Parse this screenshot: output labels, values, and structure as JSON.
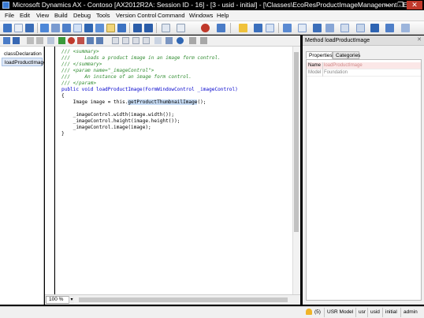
{
  "window": {
    "title": "Microsoft Dynamics AX - Contoso [AX2012R2A: Session ID - 16] - [3 - usid - initial] - [\\Classes\\EcoResProductImageManagement - Ed]",
    "minimize": "—",
    "maximize": "❐",
    "close": "✕"
  },
  "menu": [
    "File",
    "Edit",
    "View",
    "Build",
    "Debug",
    "Tools",
    "Version Control",
    "Command",
    "Windows",
    "Help"
  ],
  "methods": [
    "classDeclaration",
    "loadProductImage"
  ],
  "code": {
    "lines": [
      "/// <summary>",
      "///     Loads a product image in an image form control.",
      "/// </summary>",
      "/// <param name=\"_imageControl\">",
      "///     An instance of an image form control.",
      "/// </param>",
      "public void loadProductImage(FormWindowControl _imageControl)",
      "{",
      "    Image image = this.",
      "getProductThumbnailImage",
      "();",
      "",
      "    _imageControl.width(image.width());",
      "    _imageControl.height(image.height());",
      "    _imageControl.image(image);",
      "}"
    ]
  },
  "editor": {
    "zoom": "100 %"
  },
  "properties": {
    "title": "Method loadProductImage",
    "tabs": [
      "Properties",
      "Categories"
    ],
    "rows": [
      {
        "name": "Name",
        "value": "loadProductImage"
      },
      {
        "name": "Model",
        "value": "Foundation"
      }
    ]
  },
  "status": {
    "notifications": "(5)",
    "items": [
      "USR Model",
      "usr",
      "usid",
      "initial",
      "admin"
    ]
  },
  "colors": {
    "comment": "#2e8b2e",
    "keyword": "#0000cc",
    "selection": "#c7dcf5"
  }
}
